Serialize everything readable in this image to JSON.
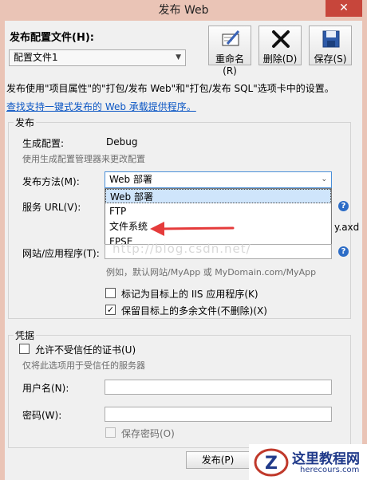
{
  "window": {
    "title": "发布 Web",
    "close_glyph": "✕"
  },
  "profile": {
    "label": "发布配置文件(H):",
    "selected": "配置文件1"
  },
  "toolbar": {
    "rename": "重命名(R)",
    "delete": "删除(D)",
    "save": "保存(S)"
  },
  "description": "发布使用\"项目属性\"的\"打包/发布 Web\"和\"打包/发布 SQL\"选项卡中的设置。",
  "link_text": "查找支持一键式发布的 Web 承载提供程序。",
  "publish_group": {
    "title": "发布",
    "build_config_label": "生成配置:",
    "build_config_value": "Debug",
    "build_config_hint": "使用生成配置管理器来更改配置",
    "method_label": "发布方法(M):",
    "method_selected": "Web 部署",
    "method_options": [
      "Web 部署",
      "FTP",
      "文件系统",
      "FPSE"
    ],
    "service_url_label": "服务 URL(V):",
    "service_url_tail": "y.axd",
    "site_label": "网站/应用程序(T):",
    "site_hint": "例如，默认网站/MyApp 或 MyDomain.com/MyApp",
    "iis_checkbox": "标记为目标上的 IIS 应用程序(K)",
    "iis_checked": false,
    "keep_checkbox": "保留目标上的多余文件(不删除)(X)",
    "keep_checked": true
  },
  "credentials_group": {
    "title": "凭据",
    "untrusted_checkbox": "允许不受信任的证书(U)",
    "untrusted_checked": false,
    "untrusted_hint": "仅将此选项用于受信任的服务器",
    "username_label": "用户名(N):",
    "username_value": "",
    "password_label": "密码(W):",
    "password_value": "",
    "save_password_checkbox": "保存密码(O)",
    "save_password_checked": false
  },
  "publish_button": "发布(P)",
  "watermark": "http://blog.csdn.net/",
  "logo": {
    "title": "这里教程网",
    "subtitle": "herecours.com"
  },
  "colors": {
    "link": "#0b56c4",
    "selection": "#cfe5fb",
    "arrow": "#e53b3b",
    "close": "#c7463b"
  }
}
